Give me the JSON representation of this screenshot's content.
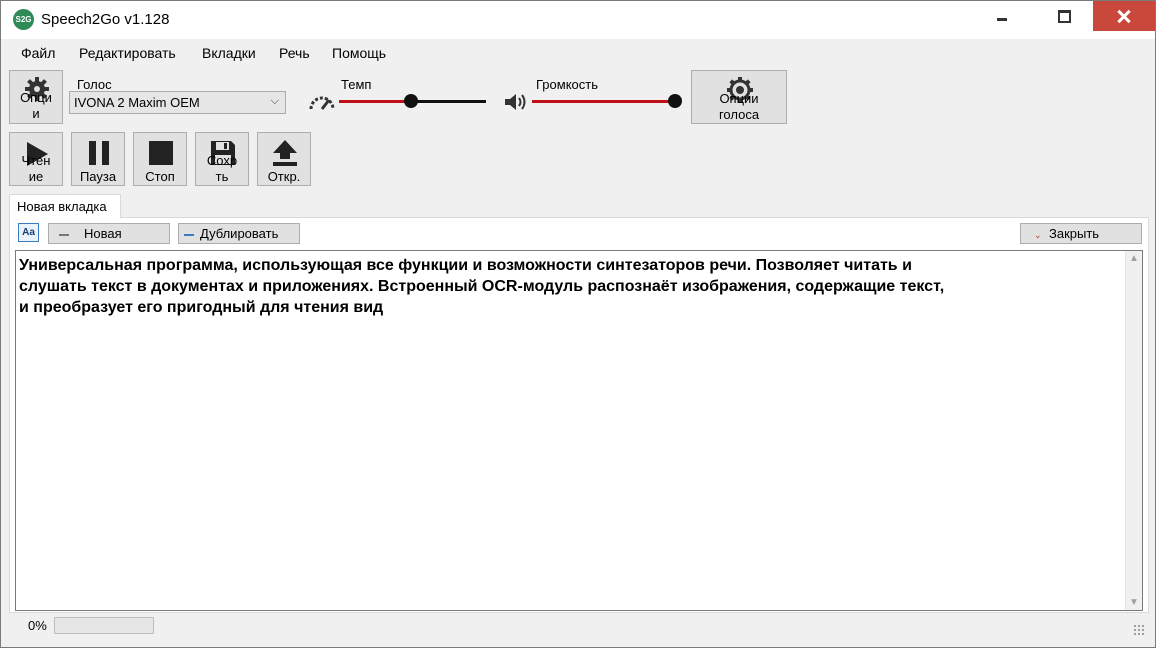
{
  "window": {
    "title": "Speech2Go v1.128",
    "logo_text": "S2G",
    "controls": {
      "minimize": "minimize-icon",
      "maximize": "maximize-icon",
      "close": "close-icon"
    }
  },
  "menu": [
    "Файл",
    "Редактировать",
    "Вкладки",
    "Речь",
    "Помощь"
  ],
  "toolbar": {
    "options_label_1": "Опци",
    "options_label_2": "и",
    "voice_label": "Голос",
    "voice_value": "IVONA 2 Maxim OEM",
    "tempo_label": "Темп",
    "tempo_value": 0.4,
    "volume_label": "Громкость",
    "volume_value": 1.0,
    "voice_options_label_1": "Опции",
    "voice_options_label_2": "голоса",
    "play_label_1": "Чтен",
    "play_label_2": "ие",
    "pause_label": "Пауза",
    "stop_label": "Стоп",
    "save_label_1": "Сохр",
    "save_label_2": "ть",
    "open_label": "Откр.",
    "accent_red": "#c0111a"
  },
  "tabs": {
    "active": "Новая вкладка"
  },
  "tab_toolbar": {
    "font_button": "Aa",
    "new_label": "Новая",
    "duplicate_label": "Дублировать",
    "close_label": "Закрыть"
  },
  "document": {
    "line1": "Универсальная программа, использующая все функции и возможности синтезаторов речи. Позволяет читать и",
    "line2": "слушать текст в документах и приложениях. Встроенный OCR-модуль распознаёт изображения, содержащие текст,",
    "line3": "и преобразует его пригодный для чтения вид"
  },
  "status": {
    "percent_text": "0%",
    "progress": 0
  }
}
